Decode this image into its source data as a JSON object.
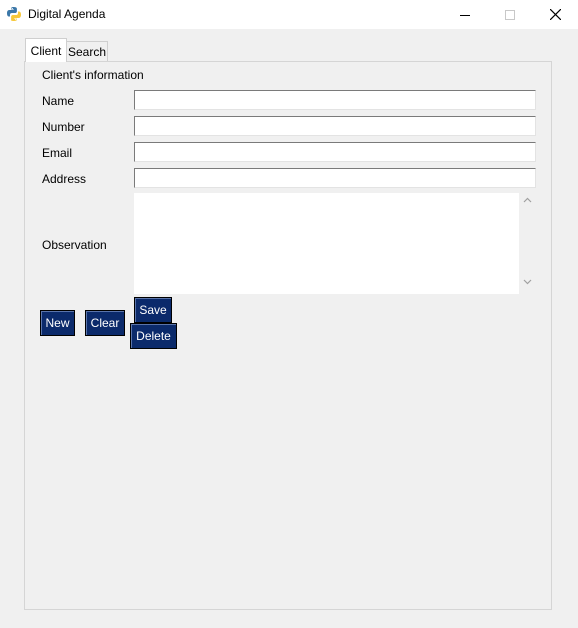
{
  "window": {
    "title": "Digital Agenda",
    "icon": "python-icon",
    "controls": [
      "minimize-icon",
      "maximize-icon",
      "close-icon"
    ]
  },
  "tabs": [
    {
      "label": "Client",
      "selected": true
    },
    {
      "label": "Search",
      "selected": false
    }
  ],
  "form": {
    "section_title": "Client's information",
    "fields": [
      {
        "label": "Name",
        "value": ""
      },
      {
        "label": "Number",
        "value": ""
      },
      {
        "label": "Email",
        "value": ""
      },
      {
        "label": "Address",
        "value": ""
      }
    ],
    "observation": {
      "label": "Observation",
      "value": ""
    }
  },
  "buttons": {
    "new": "New",
    "clear": "Clear",
    "save": "Save",
    "delete": "Delete"
  },
  "colors": {
    "button_bg": "#0b2a6b",
    "button_text": "#ffffff",
    "window_bg": "#f0f0f0"
  }
}
